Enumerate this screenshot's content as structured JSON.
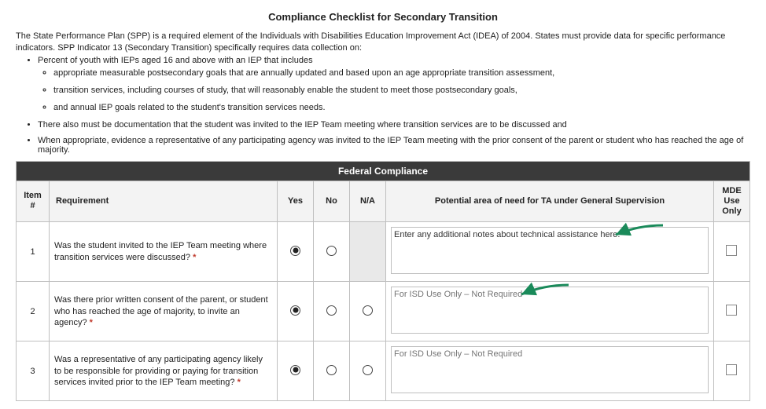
{
  "title": "Compliance Checklist for Secondary Transition",
  "intro_paragraph": "The State Performance Plan (SPP) is a required element of the Individuals with Disabilities Education Improvement Act (IDEA) of 2004. States must provide data for specific performance indicators. SPP Indicator 13 (Secondary Transition) specifically requires data collection on:",
  "bullets_lvl1": {
    "b0": "Percent of youth with IEPs aged 16 and above with an IEP that includes",
    "b1": "There also must be documentation that the student was invited to the IEP Team meeting where transition services are to be discussed and",
    "b2": "When appropriate, evidence a representative of any participating agency was invited to the IEP Team meeting with the prior consent of the parent or student who has reached the age of majority."
  },
  "bullets_lvl2": {
    "s0": "appropriate measurable postsecondary goals that are annually updated and based upon an age appropriate transition assessment,",
    "s1": "transition services, including courses of study, that will reasonably enable the student to meet those postsecondary goals,",
    "s2": "and annual IEP goals related to the student's transition services needs."
  },
  "section_header": "Federal Compliance",
  "columns": {
    "item": "Item #",
    "req": "Requirement",
    "yes": "Yes",
    "no": "No",
    "na": "N/A",
    "ta": "Potential area of need for TA under General Supervision",
    "mde": "MDE Use Only"
  },
  "rows": [
    {
      "num": "1",
      "requirement": "Was the student invited to the IEP Team meeting where transition services were discussed?",
      "yes_selected": true,
      "no_selected": false,
      "na_available": false,
      "ta_text": "Enter any additional notes about technical assistance here.",
      "ta_is_placeholder": false
    },
    {
      "num": "2",
      "requirement": "Was there prior written consent of the parent, or student who has reached the age of majority, to invite an agency?",
      "yes_selected": true,
      "no_selected": false,
      "na_available": true,
      "ta_text": "For ISD Use Only – Not Required",
      "ta_is_placeholder": true
    },
    {
      "num": "3",
      "requirement": "Was a representative of any participating agency likely to be responsible for providing or paying for transition services invited prior to the IEP Team meeting?",
      "yes_selected": true,
      "no_selected": false,
      "na_available": true,
      "ta_text": "For ISD Use Only – Not Required",
      "ta_is_placeholder": true
    }
  ],
  "required_marker": "*"
}
